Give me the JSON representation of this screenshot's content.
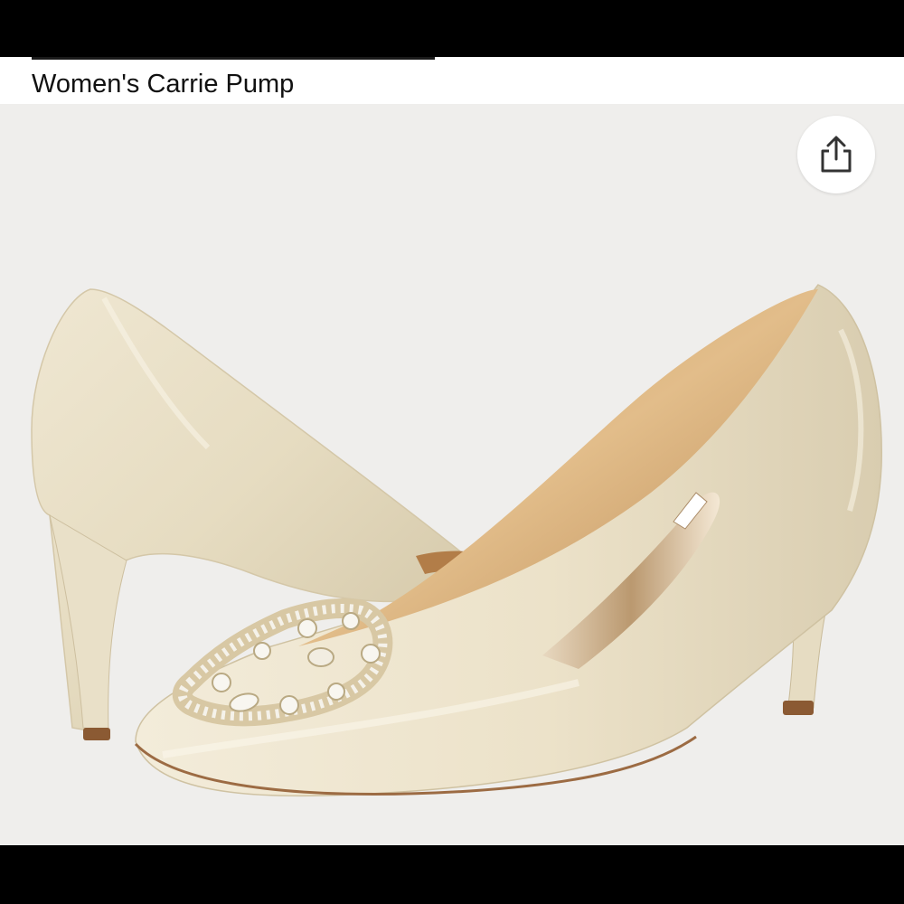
{
  "product": {
    "title": "Women's Carrie Pump",
    "image_alt": "Ivory satin pointed-toe pump with crystal buckle ornament"
  },
  "share": {
    "icon": "share-icon",
    "aria_label": "Share"
  },
  "colors": {
    "image_background": "#efeeec",
    "satin": "#e8dfc6",
    "lining": "#d9b07a",
    "crystal": "#f4f1ea"
  }
}
